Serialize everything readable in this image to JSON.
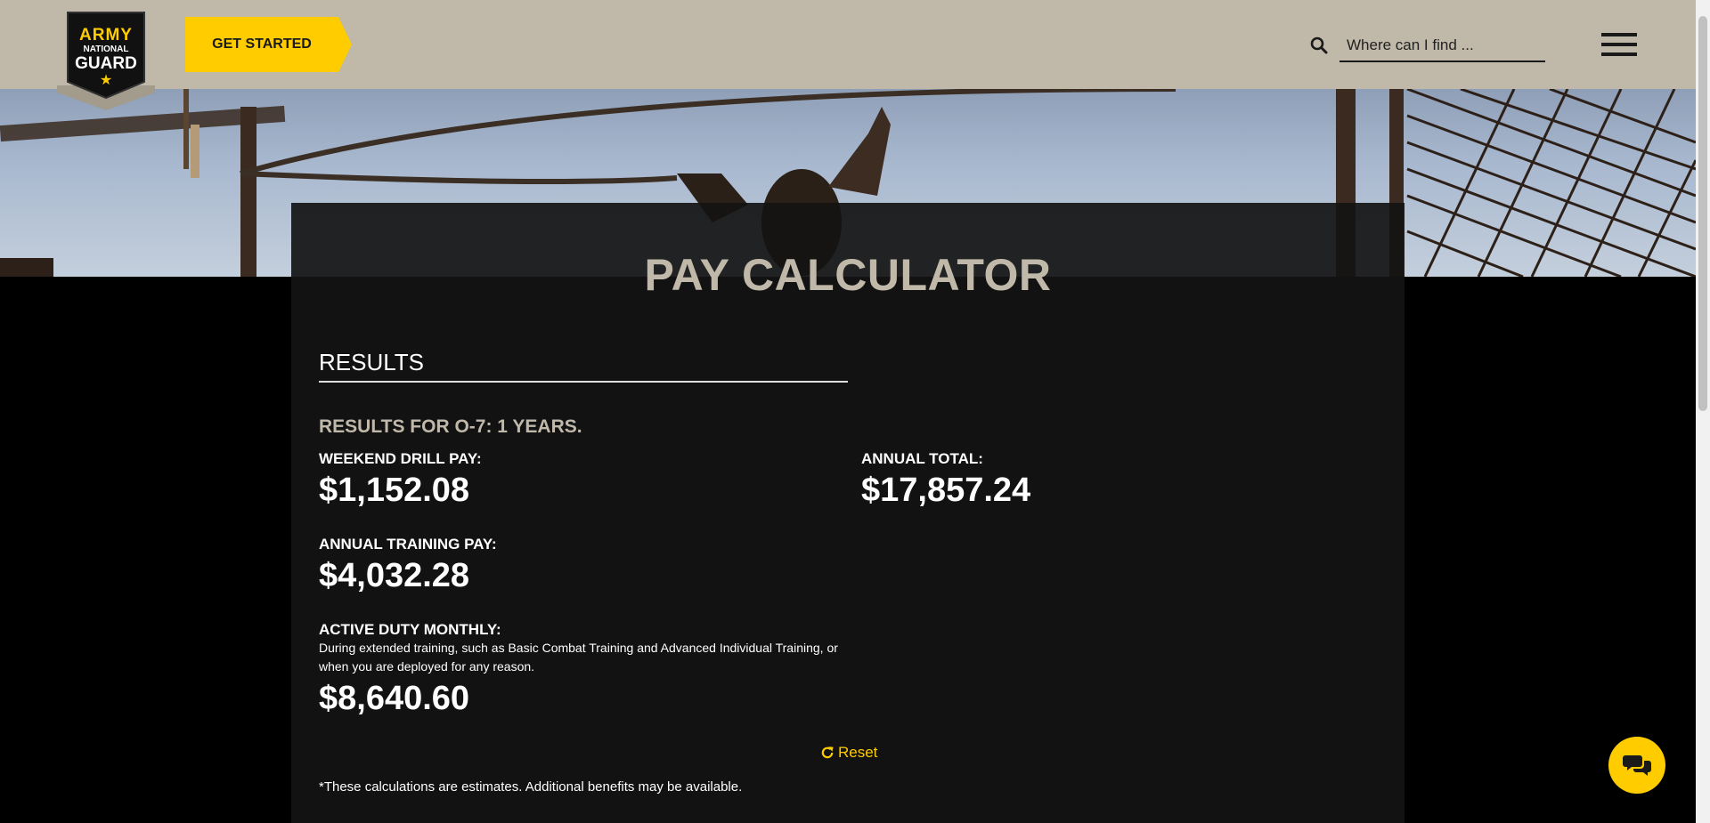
{
  "header": {
    "logo": {
      "line1": "ARMY",
      "line2": "NATIONAL",
      "line3": "GUARD",
      "star": "★"
    },
    "cta_label": "GET STARTED",
    "search": {
      "icon": "search-icon",
      "placeholder": "Where can I find ..."
    },
    "menu_icon": "hamburger-menu-icon"
  },
  "calculator": {
    "title": "PAY CALCULATOR",
    "results_heading": "RESULTS",
    "results_for": "RESULTS FOR O-7: 1 YEARS.",
    "weekend_drill": {
      "label": "WEEKEND DRILL PAY:",
      "amount": "$1,152.08"
    },
    "annual_training": {
      "label": "ANNUAL TRAINING PAY:",
      "amount": "$4,032.28"
    },
    "active_duty": {
      "label": "ACTIVE DUTY MONTHLY:",
      "description": "During extended training, such as Basic Combat Training and Advanced Individual Training, or when you are deployed for any reason.",
      "amount": "$8,640.60"
    },
    "annual_total": {
      "label": "ANNUAL TOTAL:",
      "amount": "$17,857.24"
    },
    "reset_label": "Reset",
    "disclaimer": "*These calculations are estimates. Additional benefits may be available."
  },
  "chat": {
    "icon": "chat-bubbles-icon"
  },
  "colors": {
    "header_bg": "#c0b8a9",
    "accent": "#ffcc00",
    "card_bg": "#141414",
    "page_bg": "#000000"
  }
}
